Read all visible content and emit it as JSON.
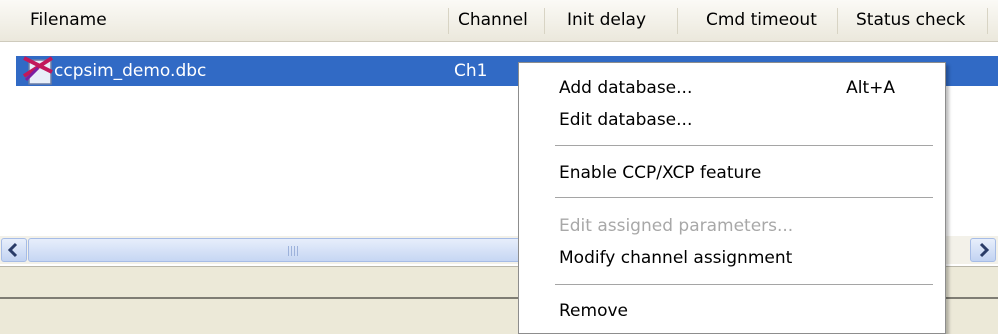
{
  "columns": [
    "Filename",
    "Channel",
    "Init delay",
    "Cmd timeout",
    "Status check"
  ],
  "row": {
    "filename": "ccpsim_demo.dbc",
    "channel": "Ch1"
  },
  "scrollbar": {
    "grip": "III"
  },
  "context_menu": {
    "items": [
      {
        "label": "Add database...",
        "shortcut": "Alt+A",
        "enabled": true
      },
      {
        "label": "Edit database...",
        "enabled": true
      },
      {
        "label": "Enable CCP/XCP feature",
        "enabled": true
      },
      {
        "label": "Edit assigned parameters...",
        "enabled": false
      },
      {
        "label": "Modify channel assignment",
        "enabled": true
      },
      {
        "label": "Remove",
        "enabled": true
      }
    ]
  },
  "colors": {
    "selection": "#316ac5",
    "window": "#ece9d8",
    "disabled_text": "#a8a8a8"
  }
}
